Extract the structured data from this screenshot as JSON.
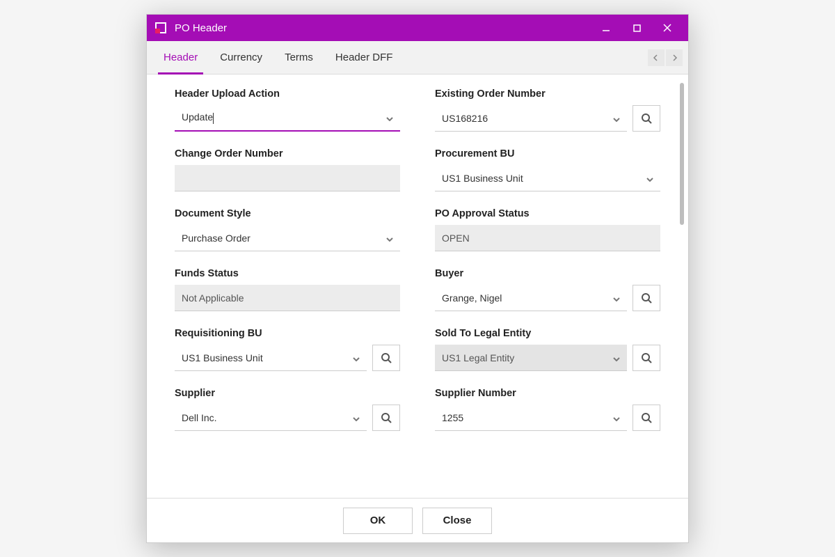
{
  "window": {
    "title": "PO Header"
  },
  "tabs": [
    {
      "label": "Header",
      "active": true
    },
    {
      "label": "Currency",
      "active": false
    },
    {
      "label": "Terms",
      "active": false
    },
    {
      "label": "Header DFF",
      "active": false
    }
  ],
  "fields": {
    "header_upload_action": {
      "label": "Header Upload Action",
      "value": "Update"
    },
    "existing_order_number": {
      "label": "Existing Order Number",
      "value": "US168216"
    },
    "change_order_number": {
      "label": "Change Order Number",
      "value": ""
    },
    "procurement_bu": {
      "label": "Procurement BU",
      "value": "US1 Business Unit"
    },
    "document_style": {
      "label": "Document Style",
      "value": "Purchase Order"
    },
    "po_approval_status": {
      "label": "PO Approval Status",
      "value": "OPEN"
    },
    "funds_status": {
      "label": "Funds Status",
      "value": "Not Applicable"
    },
    "buyer": {
      "label": "Buyer",
      "value": "Grange, Nigel"
    },
    "requisitioning_bu": {
      "label": "Requisitioning BU",
      "value": "US1 Business Unit"
    },
    "sold_to_legal_entity": {
      "label": "Sold To Legal Entity",
      "value": "US1 Legal Entity"
    },
    "supplier": {
      "label": "Supplier",
      "value": "Dell Inc."
    },
    "supplier_number": {
      "label": "Supplier Number",
      "value": "1255"
    }
  },
  "footer": {
    "ok": "OK",
    "close": "Close"
  }
}
